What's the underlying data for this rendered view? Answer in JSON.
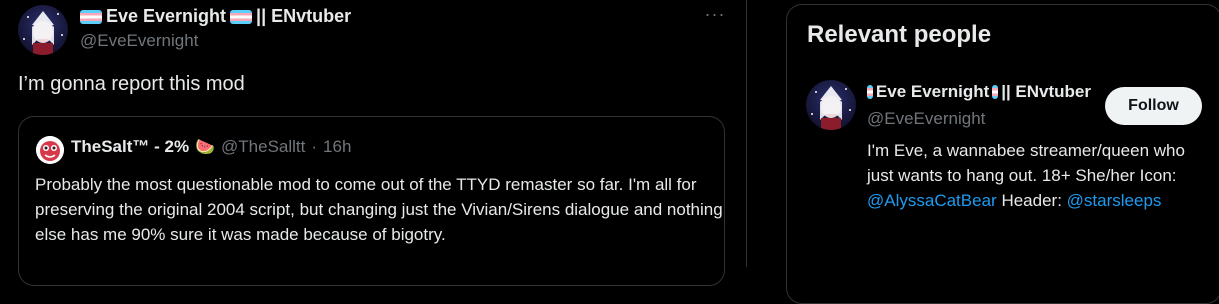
{
  "tweet": {
    "author": {
      "name": "Eve Evernight",
      "name_suffix": "|| ENvtuber",
      "handle": "@EveEvernight"
    },
    "more_label": "···",
    "text": "I’m gonna report this mod",
    "quote": {
      "name": "TheSalt™ - 2%",
      "emoji": "🍉",
      "handle": "@TheSalltt",
      "separator": "·",
      "time": "16h",
      "text": "Probably the most questionable mod to come out of the TTYD remaster so far. I'm all for preserving the original 2004 script, but changing just the Vivian/Sirens dialogue and nothing else has me 90% sure it was made because of bigotry."
    }
  },
  "sidebar": {
    "title": "Relevant people",
    "person": {
      "name": "Eve Evernight",
      "name_suffix": "|| ENvtuber",
      "handle": "@EveEvernight",
      "follow_label": "Follow",
      "bio_prefix": "I'm Eve, a wannabee streamer/queen who just wants to hang out. 18+ She/her Icon:",
      "mention_icon": "@AlyssaCatBear",
      "bio_middle": "Header:",
      "mention_header": "@starsleeps"
    }
  },
  "colors": {
    "background": "#000000",
    "text": "#e7e9ea",
    "muted": "#71767b",
    "border": "#2f3336",
    "link": "#1d9bf0",
    "button_bg": "#eff3f4",
    "button_text": "#0f1419"
  },
  "icons": {
    "flag": "trans-flag-icon",
    "more": "more-horizontal-icon",
    "melon": "watermelon-emoji"
  }
}
